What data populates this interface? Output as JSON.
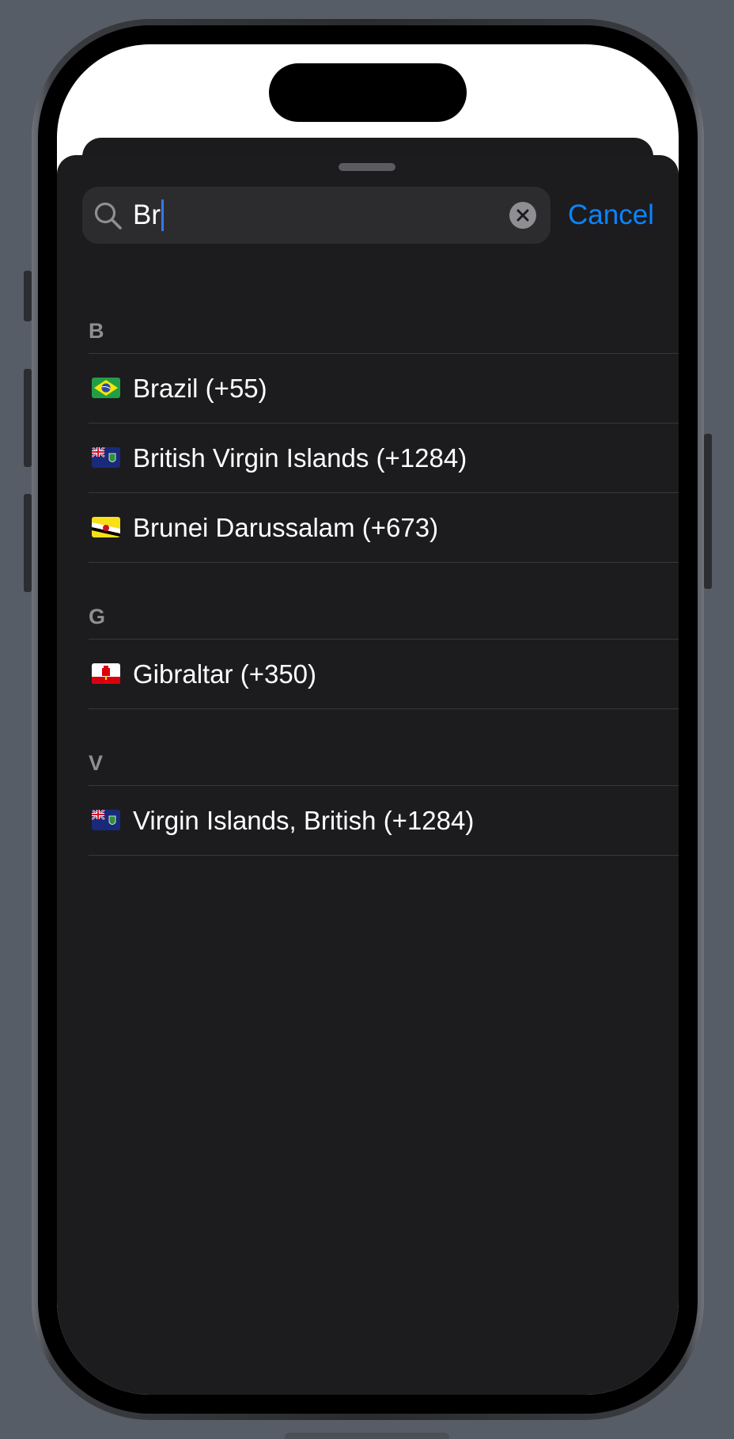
{
  "search": {
    "value": "Br",
    "cancel_label": "Cancel"
  },
  "sections": [
    {
      "letter": "B",
      "rows": [
        {
          "name": "Brazil (+55)",
          "flag": "brazil-flag-icon"
        },
        {
          "name": "British Virgin Islands (+1284)",
          "flag": "british-virgin-islands-flag-icon"
        },
        {
          "name": "Brunei Darussalam (+673)",
          "flag": "brunei-flag-icon"
        }
      ]
    },
    {
      "letter": "G",
      "rows": [
        {
          "name": "Gibraltar (+350)",
          "flag": "gibraltar-flag-icon"
        }
      ]
    },
    {
      "letter": "V",
      "rows": [
        {
          "name": "Virgin Islands, British (+1284)",
          "flag": "british-virgin-islands-flag-icon"
        }
      ]
    }
  ],
  "colors": {
    "accent": "#0a84ff",
    "sheet_background": "#1c1c1e",
    "search_background": "#2c2c2e",
    "section_header": "#8e8e93",
    "separator": "#38383a"
  }
}
